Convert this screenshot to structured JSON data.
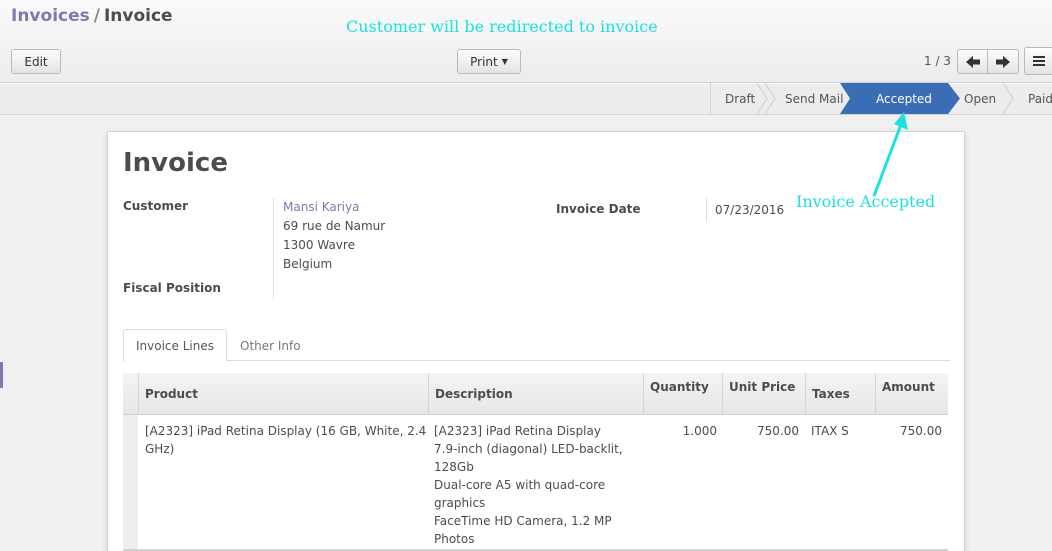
{
  "breadcrumb": {
    "parent": "Invoices",
    "separator": "/",
    "current": "Invoice"
  },
  "annotations": {
    "top_note": "Customer will be redirected to invoice",
    "accepted_note": "Invoice Accepted",
    "color": "#1ee0e0"
  },
  "toolbar": {
    "edit_label": "Edit",
    "print_label": "Print",
    "pager_value": "1 / 3",
    "prev_icon": "arrow-left-icon",
    "next_icon": "arrow-right-icon",
    "view_icon": "list-view-icon"
  },
  "statusbar": {
    "stages": [
      {
        "label": "Draft",
        "active": false
      },
      {
        "label": "Send Mail",
        "active": false
      },
      {
        "label": "Accepted",
        "active": true
      },
      {
        "label": "Open",
        "active": false
      },
      {
        "label": "Paid",
        "active": false
      }
    ],
    "active_color": "#3a6db6"
  },
  "form": {
    "title": "Invoice",
    "customer_label": "Customer",
    "customer": {
      "name": "Mansi Kariya",
      "street": "69 rue de Namur",
      "city": "1300 Wavre",
      "country": "Belgium"
    },
    "fiscal_position_label": "Fiscal Position",
    "invoice_date_label": "Invoice Date",
    "invoice_date": "07/23/2016"
  },
  "tabs": [
    {
      "label": "Invoice Lines",
      "active": true
    },
    {
      "label": "Other Info",
      "active": false
    }
  ],
  "lines": {
    "columns": [
      "Product",
      "Description",
      "Quantity",
      "Unit Price",
      "Taxes",
      "Amount"
    ],
    "rows": [
      {
        "product": "[A2323] iPad Retina Display (16 GB, White, 2.4 GHz)",
        "description": [
          "[A2323] iPad Retina Display",
          "7.9-inch (diagonal) LED-backlit,",
          "128Gb",
          "Dual-core A5 with quad-core",
          "graphics",
          "FaceTime HD Camera, 1.2 MP",
          "Photos"
        ],
        "quantity": "1.000",
        "unit_price": "750.00",
        "taxes": "ITAX S",
        "amount": "750.00"
      }
    ]
  }
}
